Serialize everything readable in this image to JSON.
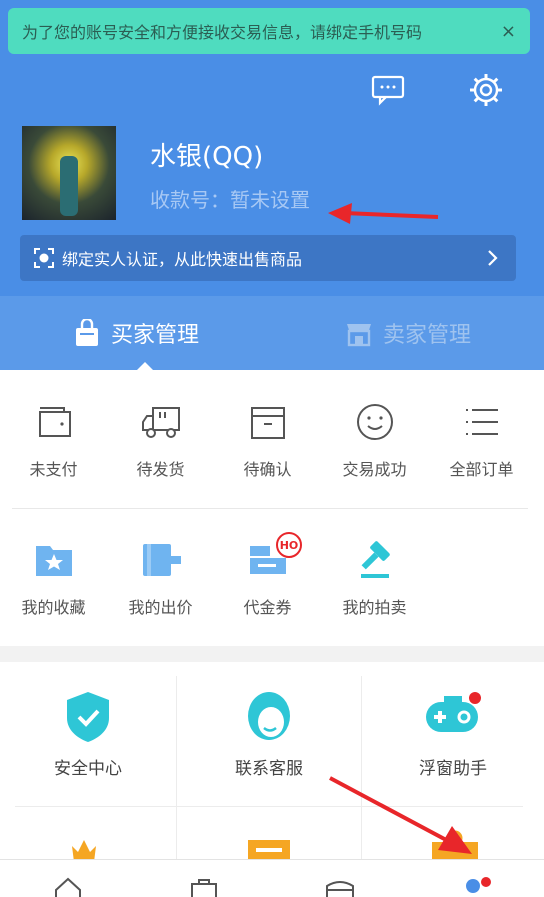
{
  "banner": {
    "text": "为了您的账号安全和方便接收交易信息，请绑定手机号码",
    "close": "×"
  },
  "header": {
    "icons": [
      "message-icon",
      "settings-icon"
    ],
    "nickname": "水银(QQ)",
    "account": "收款号：暂未设置",
    "bind_text": "绑定实人认证，从此快速出售商品"
  },
  "tabs": [
    {
      "label": "买家管理",
      "icon": "shopping-bag-icon",
      "active": true
    },
    {
      "label": "卖家管理",
      "icon": "shop-icon",
      "active": false
    }
  ],
  "orders": [
    {
      "label": "未支付",
      "icon": "wallet-icon"
    },
    {
      "label": "待发货",
      "icon": "truck-icon"
    },
    {
      "label": "待确认",
      "icon": "box-icon"
    },
    {
      "label": "交易成功",
      "icon": "smile-icon"
    },
    {
      "label": "全部订单",
      "icon": "list-icon"
    }
  ],
  "buyer_tools": [
    {
      "label": "我的收藏",
      "icon": "star-folder-icon"
    },
    {
      "label": "我的出价",
      "icon": "price-icon"
    },
    {
      "label": "代金券",
      "icon": "coupon-icon",
      "badge": "HO"
    },
    {
      "label": "我的拍卖",
      "icon": "auction-hammer-icon"
    }
  ],
  "services": [
    {
      "label": "安全中心",
      "icon": "shield-icon"
    },
    {
      "label": "联系客服",
      "icon": "customer-service-icon"
    },
    {
      "label": "浮窗助手",
      "icon": "gamepad-icon"
    }
  ],
  "bottom_nav": [
    "home-icon",
    "bag-icon",
    "store-icon",
    "profile-icon"
  ],
  "colors": {
    "header_blue": "#4a8ee6",
    "tab_blue": "#5b9ae9",
    "accent_teal": "#2ec6d6",
    "banner_green": "#4fdcbf",
    "arrow_red": "#e8262a"
  }
}
